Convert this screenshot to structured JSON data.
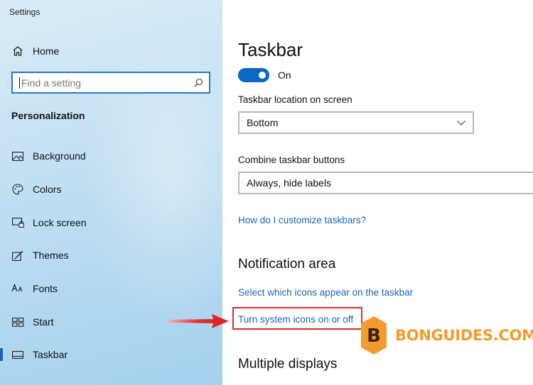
{
  "window": {
    "title": "Settings"
  },
  "sidebar": {
    "home_label": "Home",
    "search_placeholder": "Find a setting",
    "section_title": "Personalization",
    "items": [
      {
        "label": "Background",
        "icon": "image-icon"
      },
      {
        "label": "Colors",
        "icon": "palette-icon"
      },
      {
        "label": "Lock screen",
        "icon": "lock-screen-icon"
      },
      {
        "label": "Themes",
        "icon": "themes-icon"
      },
      {
        "label": "Fonts",
        "icon": "fonts-icon"
      },
      {
        "label": "Start",
        "icon": "start-icon"
      },
      {
        "label": "Taskbar",
        "icon": "taskbar-icon",
        "active": true
      }
    ]
  },
  "main": {
    "title": "Taskbar",
    "toggle": {
      "state_label": "On",
      "on": true
    },
    "location": {
      "label": "Taskbar location on screen",
      "value": "Bottom"
    },
    "combine": {
      "label": "Combine taskbar buttons",
      "value": "Always, hide labels"
    },
    "customize_link": "How do I customize taskbars?",
    "notification_area": {
      "title": "Notification area",
      "select_icons_link": "Select which icons appear on the taskbar",
      "system_icons_link": "Turn system icons on or off"
    },
    "multiple_displays_title": "Multiple displays"
  },
  "watermark": {
    "text": "BONGUIDES.COM",
    "logo_letter": "B"
  },
  "colors": {
    "accent": "#0a67c2",
    "link": "#1a66b8",
    "highlight": "#e22a2a",
    "watermark": "#f29b2e"
  }
}
